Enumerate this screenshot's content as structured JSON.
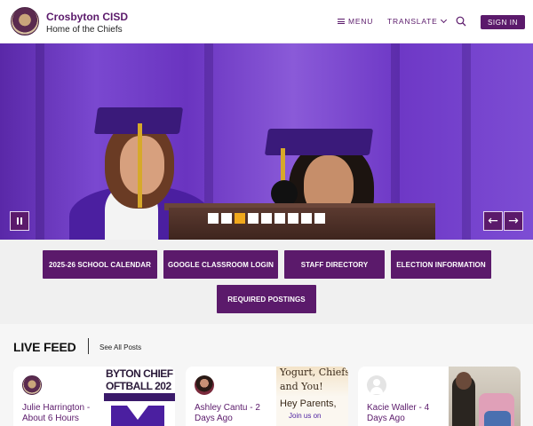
{
  "header": {
    "site_title": "Crosbyton CISD",
    "site_subtitle": "Home of the Chiefs",
    "menu_label": "MENU",
    "translate_label": "TRANSLATE",
    "signin_label": "SIGN IN",
    "brand_color": "#5b1a6b"
  },
  "hero": {
    "slide_count": 9,
    "active_slide": 3,
    "prev_arrow": "←",
    "next_arrow": "→"
  },
  "quick_links": [
    {
      "label": "2025-26 SCHOOL CALENDAR"
    },
    {
      "label": "GOOGLE CLASSROOM LOGIN"
    },
    {
      "label": "STAFF DIRECTORY"
    },
    {
      "label": "ELECTION INFORMATION"
    },
    {
      "label": "REQUIRED POSTINGS"
    }
  ],
  "live_feed": {
    "title": "LIVE FEED",
    "see_all": "See All Posts",
    "posts": [
      {
        "author": "Julie Harrington - About 6 Hours",
        "avatar": "district-logo"
      },
      {
        "author": "Ashley Cantu - 2 Days Ago",
        "avatar": "photo"
      },
      {
        "author": "Kacie Waller - 4 Days Ago",
        "avatar": "default-user"
      }
    ],
    "post_images": {
      "softball_text": "BYTON CHIEF\nOFTBALL 202",
      "yogurt_line1": "Yogurt, Chiefs",
      "yogurt_line2": "and You!",
      "yogurt_line3": "Hey Parents,",
      "yogurt_line4": "Join us on"
    }
  }
}
